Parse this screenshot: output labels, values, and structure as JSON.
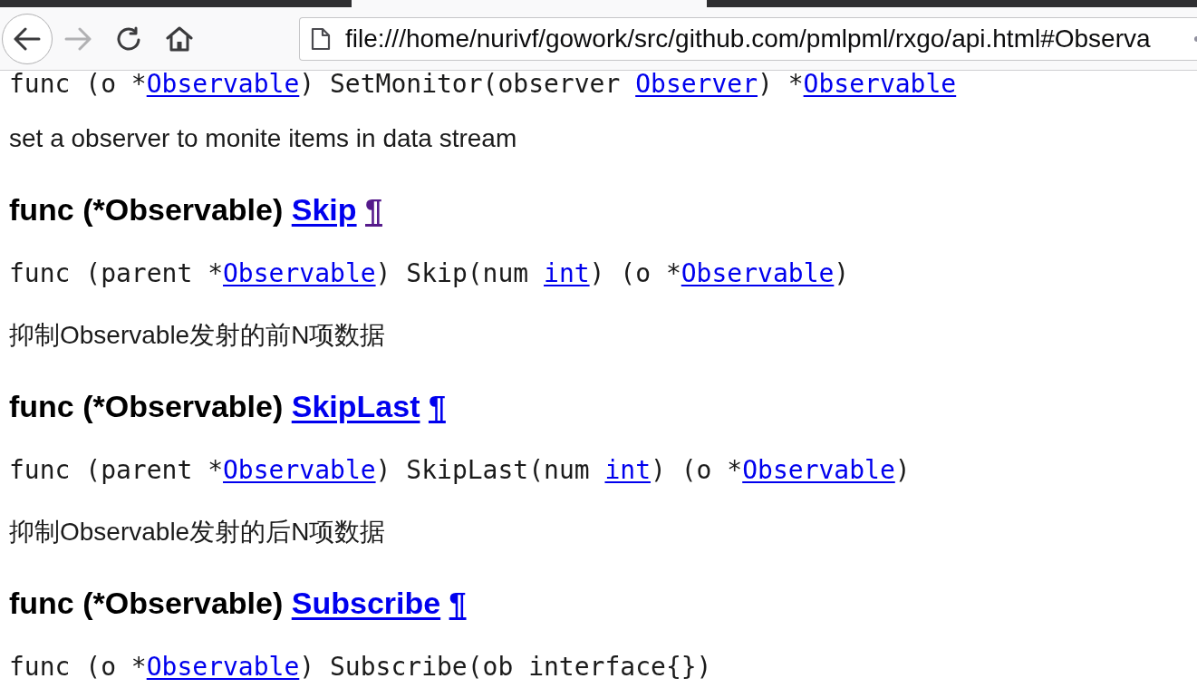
{
  "browser": {
    "tabs": [
      {
        "selected": false
      },
      {
        "selected": true
      },
      {
        "selected": false
      }
    ],
    "nav_buttons": [
      {
        "kind": "back",
        "disabled": false
      },
      {
        "kind": "forward",
        "disabled": true
      },
      {
        "kind": "reload",
        "disabled": false
      },
      {
        "kind": "home",
        "disabled": false
      }
    ],
    "url_bar": {
      "value": "file:///home/nurivf/gowork/src/github.com/pmlpml/rxgo/api.html#Observa"
    }
  },
  "content": [
    {
      "kind": "code",
      "segments": [
        {
          "kind": "text",
          "text": "func (o *"
        },
        {
          "kind": "link",
          "text": "Observable"
        },
        {
          "kind": "text",
          "text": ") SetMonitor(observer "
        },
        {
          "kind": "link",
          "text": "Observer"
        },
        {
          "kind": "text",
          "text": ") *"
        },
        {
          "kind": "link",
          "text": "Observable"
        }
      ]
    },
    {
      "kind": "paragraph",
      "text": "set a observer to monite items in data stream"
    },
    {
      "kind": "heading",
      "prefix": "func (*Observable)",
      "name": "Skip",
      "anchor": "¶",
      "anchor_visited": true
    },
    {
      "kind": "code",
      "segments": [
        {
          "kind": "text",
          "text": "func (parent *"
        },
        {
          "kind": "link",
          "text": "Observable"
        },
        {
          "kind": "text",
          "text": ") Skip(num "
        },
        {
          "kind": "link",
          "text": "int"
        },
        {
          "kind": "text",
          "text": ") (o *"
        },
        {
          "kind": "link",
          "text": "Observable"
        },
        {
          "kind": "text",
          "text": ")"
        }
      ]
    },
    {
      "kind": "paragraph",
      "text": "抑制Observable发射的前N项数据"
    },
    {
      "kind": "heading",
      "prefix": "func (*Observable)",
      "name": "SkipLast",
      "anchor": "¶",
      "anchor_visited": false
    },
    {
      "kind": "code",
      "segments": [
        {
          "kind": "text",
          "text": "func (parent *"
        },
        {
          "kind": "link",
          "text": "Observable"
        },
        {
          "kind": "text",
          "text": ") SkipLast(num "
        },
        {
          "kind": "link",
          "text": "int"
        },
        {
          "kind": "text",
          "text": ") (o *"
        },
        {
          "kind": "link",
          "text": "Observable"
        },
        {
          "kind": "text",
          "text": ")"
        }
      ]
    },
    {
      "kind": "paragraph",
      "text": "抑制Observable发射的后N项数据"
    },
    {
      "kind": "heading",
      "prefix": "func (*Observable)",
      "name": "Subscribe",
      "anchor": "¶",
      "anchor_visited": false
    },
    {
      "kind": "code",
      "segments": [
        {
          "kind": "text",
          "text": "func (o *"
        },
        {
          "kind": "link",
          "text": "Observable"
        },
        {
          "kind": "text",
          "text": ") Subscribe(ob interface{})"
        }
      ]
    }
  ]
}
